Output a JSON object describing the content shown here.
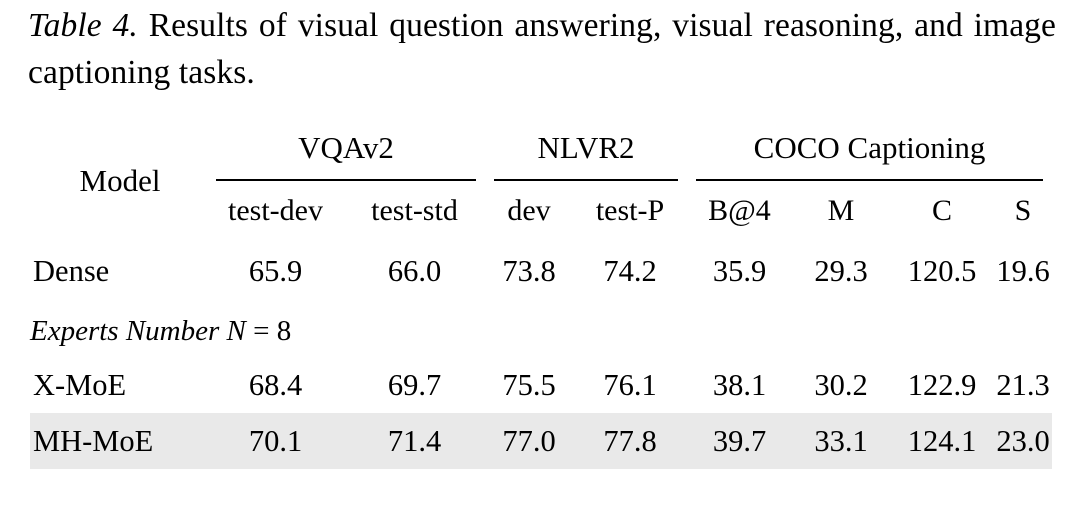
{
  "caption": {
    "label": "Table 4.",
    "text": " Results of visual question answering, visual reasoning, and image captioning tasks."
  },
  "table": {
    "row_header_label": "Model",
    "groups": [
      {
        "name": "VQAv2",
        "span": 2
      },
      {
        "name": "NLVR2",
        "span": 2
      },
      {
        "name": "COCO Captioning",
        "span": 4
      }
    ],
    "subheaders": [
      "test-dev",
      "test-std",
      "dev",
      "test-P",
      "B@4",
      "M",
      "C",
      "S"
    ],
    "sections": [
      {
        "title": null,
        "rows": [
          {
            "model": "Dense",
            "values": [
              "65.9",
              "66.0",
              "73.8",
              "74.2",
              "35.9",
              "29.3",
              "120.5",
              "19.6"
            ],
            "highlighted": false,
            "bold": false
          }
        ]
      },
      {
        "title_prefix": "Experts Number ",
        "title_var": "N",
        "title_eq": " = ",
        "title_value": "8",
        "rows": [
          {
            "model": "X-MoE",
            "values": [
              "68.4",
              "69.7",
              "75.5",
              "76.1",
              "38.1",
              "30.2",
              "122.9",
              "21.3"
            ],
            "highlighted": false,
            "bold": false
          },
          {
            "model": "MH-MoE",
            "values": [
              "70.1",
              "71.4",
              "77.0",
              "77.8",
              "39.7",
              "33.1",
              "124.1",
              "23.0"
            ],
            "highlighted": true,
            "bold": true
          }
        ]
      }
    ]
  },
  "colors": {
    "highlight_row_background": "#e9e9e9",
    "rule": "#000000",
    "text": "#000000",
    "page_background": "#ffffff"
  }
}
